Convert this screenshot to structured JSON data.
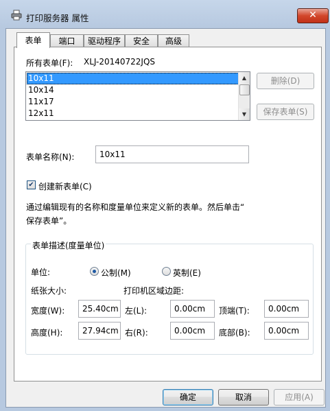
{
  "window": {
    "title": "打印服务器 属性",
    "close": "✕"
  },
  "tabs": [
    {
      "label": "表单",
      "active": true
    },
    {
      "label": "端口",
      "active": false
    },
    {
      "label": "驱动程序",
      "active": false
    },
    {
      "label": "安全",
      "active": false
    },
    {
      "label": "高级",
      "active": false
    }
  ],
  "forms": {
    "label": "所有表单(F):",
    "server_name": "XLJ-20140722JQS",
    "items": [
      "10x11",
      "10x14",
      "11x17",
      "12x11"
    ],
    "selected": "10x11"
  },
  "buttons": {
    "delete": "删除(D)",
    "save_form": "保存表单(S)",
    "ok": "确定",
    "cancel": "取消",
    "apply": "应用(A)"
  },
  "form_name": {
    "label": "表单名称(N):",
    "value": "10x11"
  },
  "create_new": {
    "label": "创建新表单(C)",
    "checked": true
  },
  "instructions": {
    "line1": "通过编辑现有的名称和度量单位来定义新的表单。然后单击“",
    "line2": "保存表单”。"
  },
  "description": {
    "group_title": "表单描述(度量单位)",
    "unit_label": "单位:",
    "metric": "公制(M)",
    "imperial": "英制(E)",
    "unit_selected": "metric",
    "paper_size_label": "纸张大小:",
    "print_area_label": "打印机区域边距:",
    "width_label": "宽度(W):",
    "width": "25.40cm",
    "height_label": "高度(H):",
    "height": "27.94cm",
    "left_label": "左(L):",
    "left": "0.00cm",
    "right_label": "右(R):",
    "right": "0.00cm",
    "top_label": "顶端(T):",
    "top": "0.00cm",
    "bottom_label": "底部(B):",
    "bottom": "0.00cm"
  },
  "icons": {
    "window": "printer-icon",
    "checkbox": "check-icon",
    "scroll_up": "arrow-up-icon",
    "scroll_down": "arrow-down-icon"
  }
}
